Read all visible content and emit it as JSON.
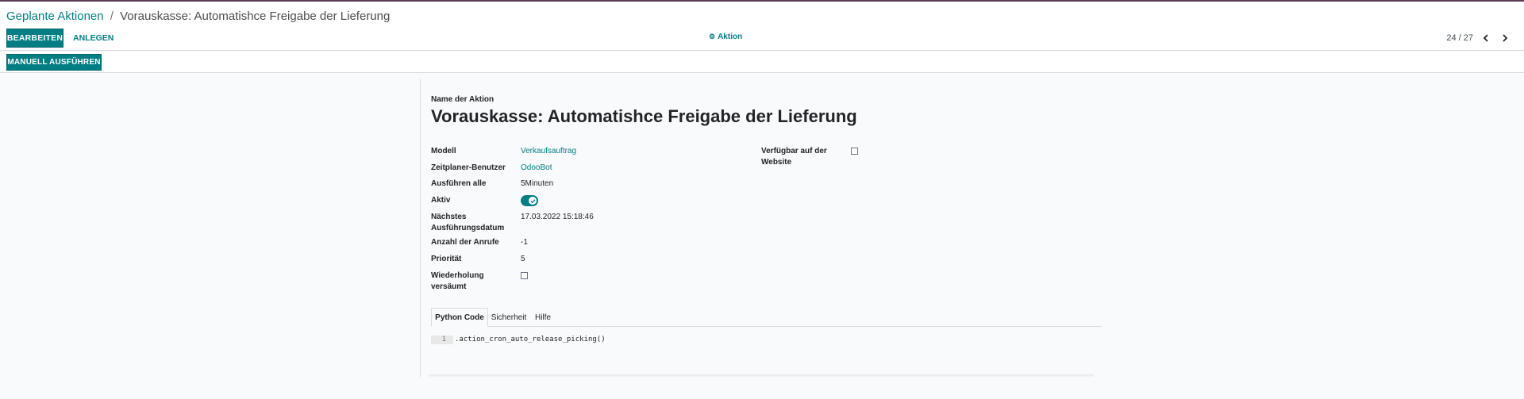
{
  "breadcrumb": {
    "parent": "Geplante Aktionen",
    "separator": "/",
    "current": "Vorauskasse: Automatishce Freigabe der Lieferung"
  },
  "toolbar": {
    "edit_label": "BEARBEITEN",
    "create_label": "ANLEGEN",
    "action_label": "Aktion",
    "action_icon": "gear-icon"
  },
  "pager": {
    "value": "24 / 27",
    "prev_icon": "chevron-left-icon",
    "next_icon": "chevron-right-icon"
  },
  "statusbar": {
    "run_manually_label": "MANUELL AUSFÜHREN"
  },
  "form": {
    "title_label": "Name der Aktion",
    "title": "Vorauskasse: Automatishce Freigabe der Lieferung",
    "fields": {
      "model": {
        "label": "Modell",
        "value": "Verkaufsauftrag"
      },
      "user": {
        "label": "Zeitplaner-Benutzer",
        "value": "OdooBot"
      },
      "interval": {
        "label": "Ausführen alle",
        "value": "5Minuten"
      },
      "active": {
        "label": "Aktiv",
        "checked": true
      },
      "nextcall": {
        "label_line1": "Nächstes",
        "label_line2": "Ausführungsdatum",
        "value": "17.03.2022 15:18:46"
      },
      "numbercall": {
        "label": "Anzahl der Anrufe",
        "value": "-1"
      },
      "priority": {
        "label": "Priorität",
        "value": "5"
      },
      "doall": {
        "label_line1": "Wiederholung",
        "label_line2": "versäumt",
        "checked": false
      },
      "website": {
        "label_line1": "Verfügbar auf der",
        "label_line2": "Website",
        "checked": false
      }
    },
    "tabs": [
      {
        "label": "Python Code",
        "active": true
      },
      {
        "label": "Sicherheit",
        "active": false
      },
      {
        "label": "Hilfe",
        "active": false
      }
    ],
    "code": {
      "line_number": "1",
      "line": ".action_cron_auto_release_picking()"
    }
  },
  "colors": {
    "primary": "#017e84",
    "top_bar": "#5b3b57"
  }
}
